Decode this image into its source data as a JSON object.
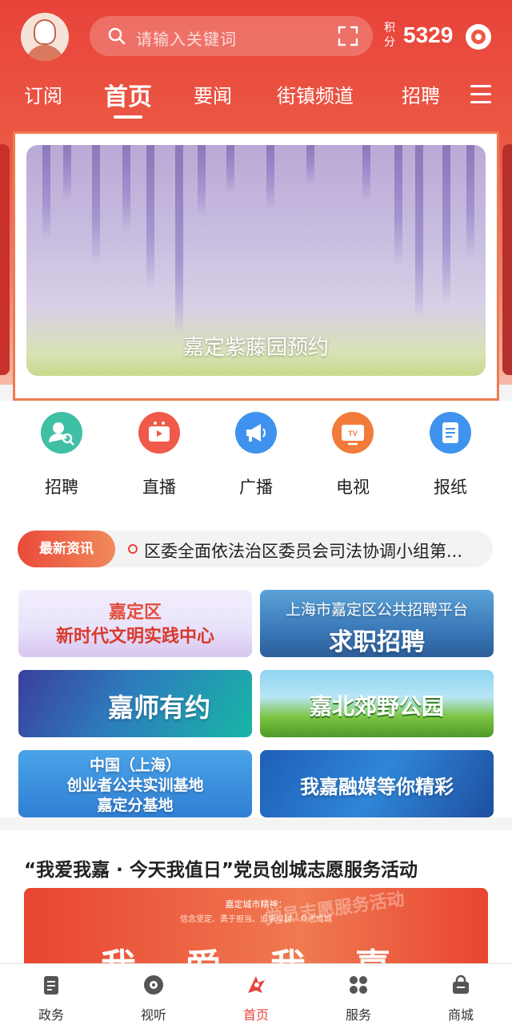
{
  "header": {
    "search_placeholder": "请输入关键词",
    "points_label": "积分",
    "points_value": "5329",
    "tabs": [
      {
        "label": "订阅"
      },
      {
        "label": "首页",
        "active": true
      },
      {
        "label": "要闻"
      },
      {
        "label": "街镇频道"
      },
      {
        "label": "招聘"
      }
    ],
    "accent_color": "#e8433a"
  },
  "banner": {
    "caption": "嘉定紫藤园预约"
  },
  "quick_links": [
    {
      "label": "招聘",
      "icon": "recruit-icon",
      "color": "#3fbfa4"
    },
    {
      "label": "直播",
      "icon": "live-video-icon",
      "color": "#ef5a4a"
    },
    {
      "label": "广播",
      "icon": "megaphone-icon",
      "color": "#3f93ef"
    },
    {
      "label": "电视",
      "icon": "tv-icon",
      "color": "#f27a3a"
    },
    {
      "label": "报纸",
      "icon": "newspaper-icon",
      "color": "#3f93ef"
    }
  ],
  "ticker": {
    "badge": "最新资讯",
    "text": "区委全面依法治区委员会司法协调小组第..."
  },
  "tiles": [
    {
      "lines": [
        "嘉定区",
        "新时代文明实践中心"
      ]
    },
    {
      "lines": [
        "上海市嘉定区公共招聘平台",
        "求职招聘"
      ]
    },
    {
      "lines": [
        "嘉师有约"
      ]
    },
    {
      "lines": [
        "嘉北郊野公园"
      ]
    },
    {
      "lines": [
        "中国（上海）",
        "创业者公共实训基地",
        "嘉定分基地"
      ]
    },
    {
      "lines": [
        "我嘉融媒等你精彩"
      ]
    }
  ],
  "article": {
    "title": "“我爱我嘉 · 今天我值日”党员创城志愿服务活动",
    "image_line1": "嘉定城市精神：",
    "image_line2": "信念坚定、勇于担当、追求卓越、众志成城",
    "image_big": "我爱我嘉",
    "image_watermark": "党员志愿服务活动"
  },
  "bottom_nav": [
    {
      "label": "政务",
      "icon": "government-doc-icon"
    },
    {
      "label": "视听",
      "icon": "disc-icon"
    },
    {
      "label": "首页",
      "icon": "home-logo-icon",
      "active": true
    },
    {
      "label": "服务",
      "icon": "grid-services-icon"
    },
    {
      "label": "商城",
      "icon": "shopping-bag-icon"
    }
  ]
}
